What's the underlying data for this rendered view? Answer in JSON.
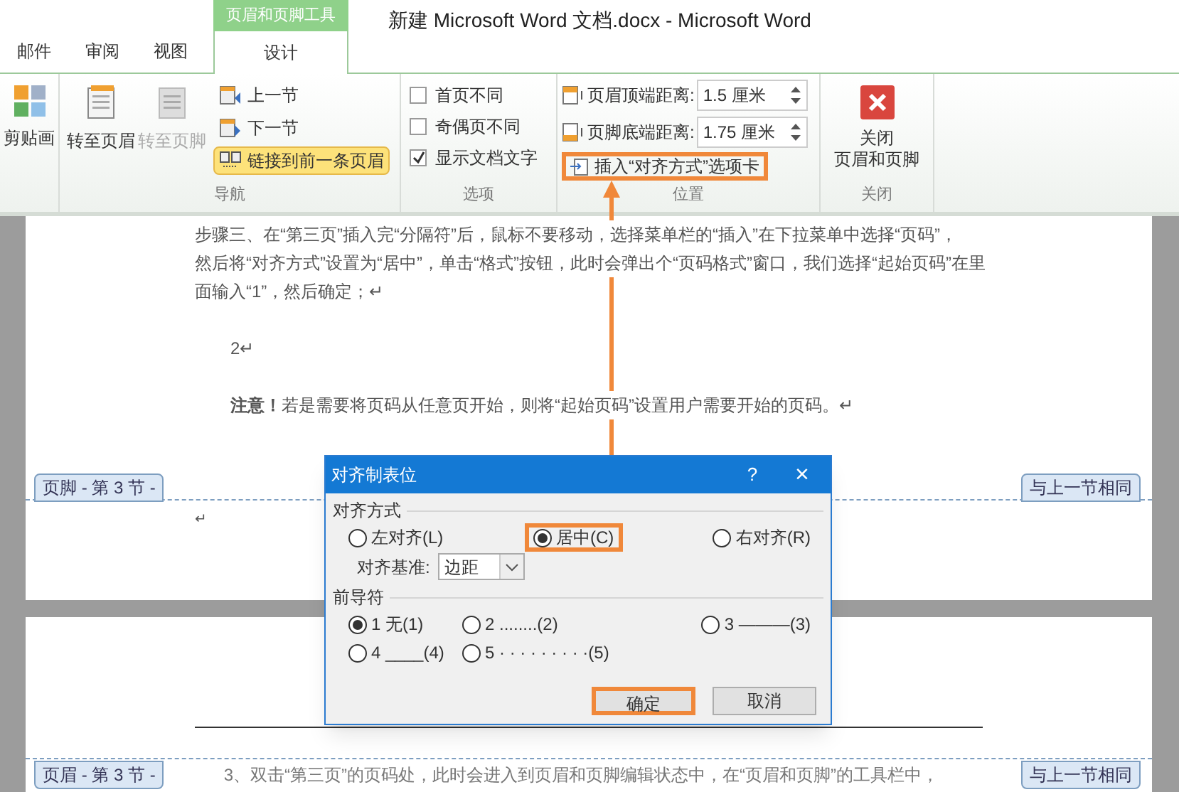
{
  "window": {
    "title": "新建 Microsoft Word 文档.docx  -  Microsoft Word"
  },
  "contextual_tab_group": "页眉和页脚工具",
  "tabs": [
    {
      "label": "邮件",
      "selected": false
    },
    {
      "label": "审阅",
      "selected": false
    },
    {
      "label": "视图",
      "selected": false
    },
    {
      "label": "设计",
      "selected": true
    }
  ],
  "clipart_group": {
    "button": "剪贴画"
  },
  "navigation_group": {
    "label": "导航",
    "large_buttons": [
      {
        "label": "转至页眉",
        "disabled": false
      },
      {
        "label": "转至页脚",
        "disabled": true
      }
    ],
    "small_buttons": [
      {
        "label": "上一节",
        "kind": "prev",
        "selected": false
      },
      {
        "label": "下一节",
        "kind": "next",
        "selected": false
      },
      {
        "label": "链接到前一条页眉",
        "kind": "link",
        "selected": true
      }
    ]
  },
  "options_group": {
    "label": "选项",
    "checkboxes": [
      {
        "label": "首页不同",
        "checked": false
      },
      {
        "label": "奇偶页不同",
        "checked": false
      },
      {
        "label": "显示文档文字",
        "checked": true
      }
    ]
  },
  "position_group": {
    "label": "位置",
    "fields": [
      {
        "label": "页眉顶端距离:",
        "value": "1.5 厘米"
      },
      {
        "label": "页脚底端距离:",
        "value": "1.75 厘米"
      }
    ],
    "insert_tab_button": {
      "label": "插入“对齐方式”选项卡",
      "highlighted": true
    }
  },
  "close_group": {
    "label": "关闭",
    "button_lines": [
      "关闭",
      "页眉和页脚"
    ]
  },
  "document": {
    "paragraphs": [
      {
        "text": "步骤三、在“第三页”插入完“分隔符”后，鼠标不要移动，选择菜单栏的“插入”在下拉菜单中选择“页码”，",
        "kind": "body"
      },
      {
        "text": "然后将“对齐方式”设置为“居中”，单击“格式”按钮，此时会弹出个“页码格式”窗口，我们选择“起始页码”在里",
        "kind": "body"
      },
      {
        "text": "面输入“1”，然后确定；↵",
        "kind": "body"
      },
      {
        "text": "2↵",
        "kind": "indent"
      },
      {
        "text": "**注意！**若是需要将页码从任意页开始，则将“起始页码”设置用户需要开始的页码。↵",
        "kind": "indent"
      }
    ],
    "footer_label": "页脚 - 第 3 节 -",
    "footer_link": "与上一节相同",
    "footer_mark": "↵",
    "header_label": "页眉 - 第 3 节 -",
    "header_link": "与上一节相同",
    "next_page_text": "3、双击“第三页”的页码处，此时会进入到页眉和页脚编辑状态中，在“页眉和页脚”的工具栏中，"
  },
  "dialog": {
    "title": "对齐制表位",
    "help": "?",
    "close": "×",
    "alignment": {
      "label": "对齐方式",
      "options": [
        {
          "label": "左对齐(L)",
          "selected": false,
          "highlighted": false
        },
        {
          "label": "居中(C)",
          "selected": true,
          "highlighted": true
        },
        {
          "label": "右对齐(R)",
          "selected": false,
          "highlighted": false
        }
      ]
    },
    "base": {
      "label": "对齐基准:",
      "value": "边距"
    },
    "leader": {
      "label": "前导符",
      "options": [
        {
          "label": "1 无(1)",
          "selected": true
        },
        {
          "label": "2 ........(2)",
          "selected": false
        },
        {
          "label": "3 ———(3)",
          "selected": false
        },
        {
          "label": "4 ____(4)",
          "selected": false
        },
        {
          "label": "5 · · · · · · · · ·(5)",
          "selected": false
        }
      ]
    },
    "buttons": [
      {
        "label": "确定",
        "highlighted": true
      },
      {
        "label": "取消",
        "highlighted": false
      }
    ]
  }
}
